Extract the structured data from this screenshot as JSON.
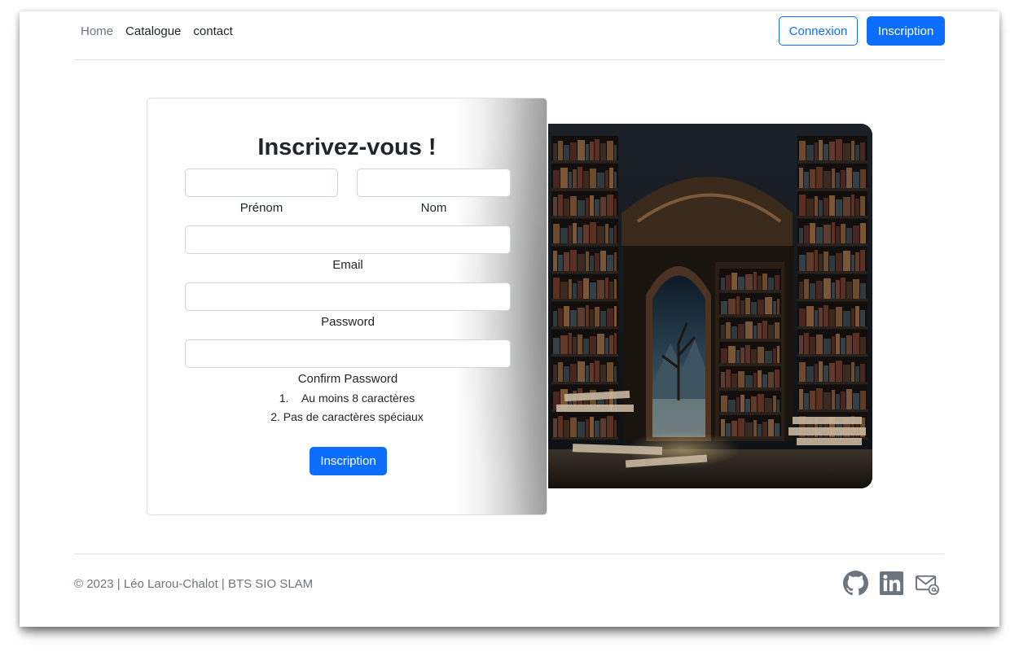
{
  "nav": {
    "links": [
      "Home",
      "Catalogue",
      "contact"
    ],
    "login_label": "Connexion",
    "signup_label": "Inscription"
  },
  "form": {
    "title": "Inscrivez-vous !",
    "firstname_label": "Prénom",
    "lastname_label": "Nom",
    "email_label": "Email",
    "password_label": "Password",
    "confirm_label": "Confirm Password",
    "rules": [
      "1.    Au moins 8 caractères",
      "2. Pas de caractères spéciaux"
    ],
    "submit_label": "Inscription"
  },
  "footer": {
    "copyright": "© 2023 | Léo Larou-Chalot | BTS SIO SLAM",
    "icons": [
      "github-icon",
      "linkedin-icon",
      "email-icon"
    ]
  },
  "colors": {
    "primary": "#0d6efd",
    "muted": "#6c757d",
    "text": "#212529",
    "border": "#dee2e6"
  }
}
